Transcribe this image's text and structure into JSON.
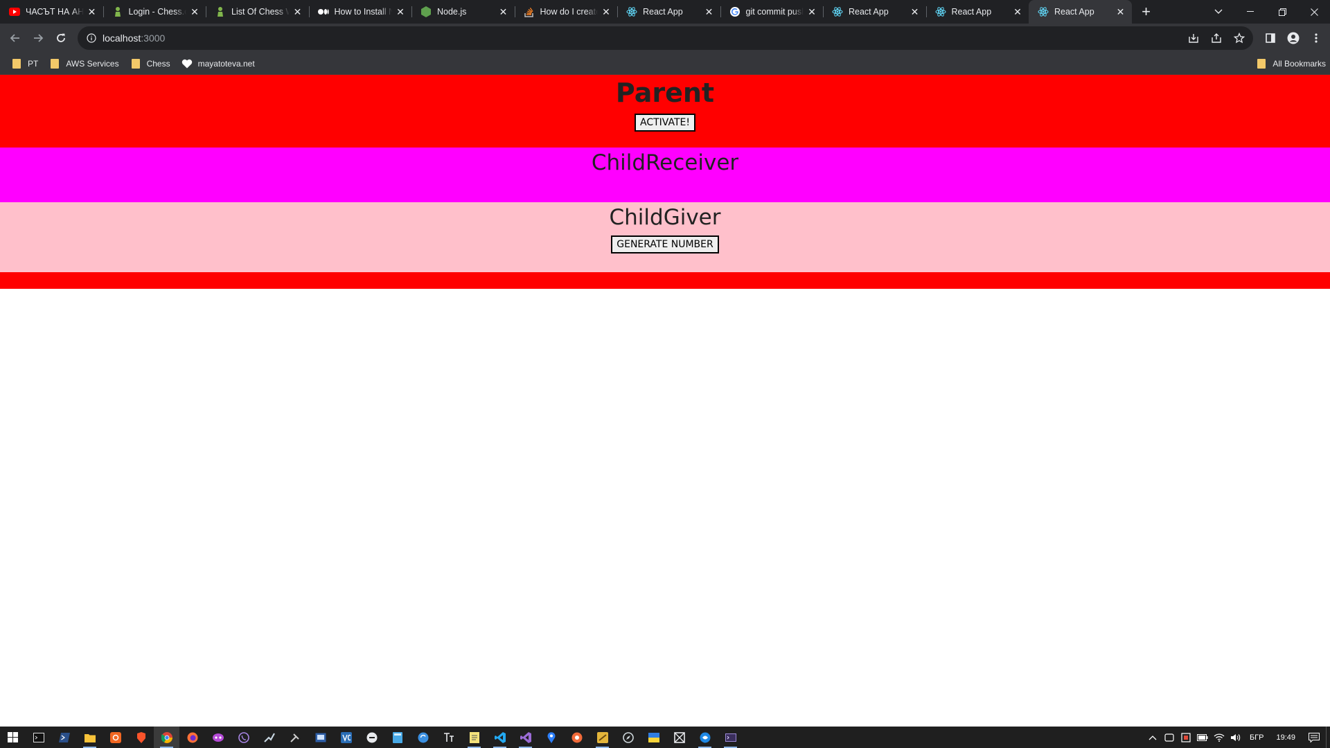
{
  "tabs": [
    {
      "title": "ЧАСЪТ НА АНА",
      "favicon": "youtube-icon"
    },
    {
      "title": "Login - Chess.com",
      "favicon": "chess-pawn-icon"
    },
    {
      "title": "List Of Chess Wins",
      "favicon": "chess-pawn-icon"
    },
    {
      "title": "How to Install Node",
      "favicon": "medium-icon"
    },
    {
      "title": "Node.js",
      "favicon": "nodejs-icon"
    },
    {
      "title": "How do I create",
      "favicon": "stackoverflow-icon"
    },
    {
      "title": "React App",
      "favicon": "react-icon"
    },
    {
      "title": "git commit push",
      "favicon": "google-icon"
    },
    {
      "title": "React App",
      "favicon": "react-icon"
    },
    {
      "title": "React App",
      "favicon": "react-icon"
    },
    {
      "title": "React App",
      "favicon": "react-icon",
      "active": true
    }
  ],
  "address": {
    "host": "localhost",
    "port": ":3000"
  },
  "bookmarks": [
    {
      "label": "PT",
      "icon": "folder-icon"
    },
    {
      "label": "AWS Services",
      "icon": "folder-icon"
    },
    {
      "label": "Chess",
      "icon": "folder-icon"
    },
    {
      "label": "mayatoteva.net",
      "icon": "heart-icon"
    }
  ],
  "bookmarks_right": {
    "label": "All Bookmarks",
    "icon": "folder-icon"
  },
  "page": {
    "parent_title": "Parent",
    "activate_label": "ACTIVATE!",
    "receiver_title": "ChildReceiver",
    "giver_title": "ChildGiver",
    "generate_label": "GENERATE NUMBER"
  },
  "colors": {
    "parent_bg": "#ff0000",
    "receiver_bg": "#ff00ff",
    "giver_bg": "#ffc0cb"
  },
  "taskbar": {
    "language": "БГР",
    "time": "19:49"
  }
}
